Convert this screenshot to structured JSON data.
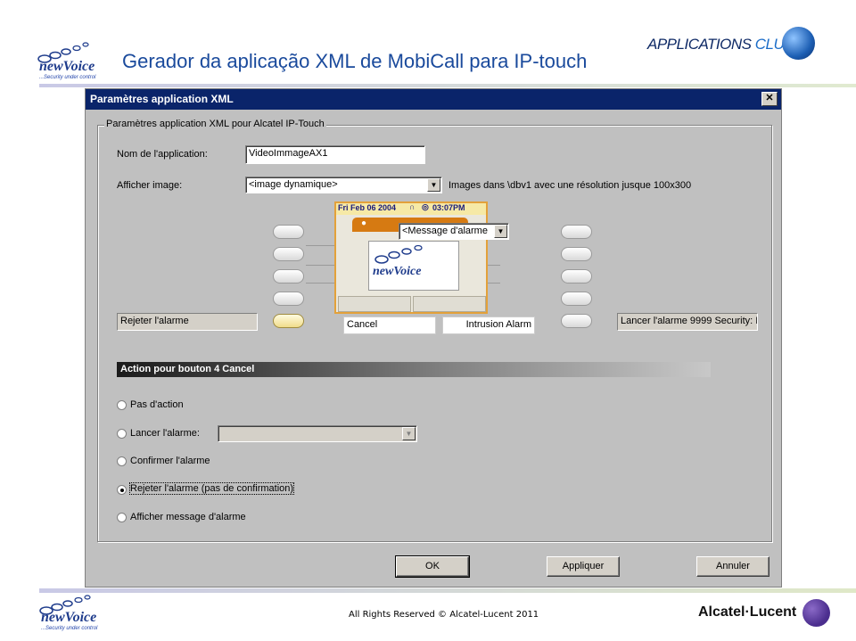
{
  "slide": {
    "title": "Gerador da aplicação XML de MobiCall para IP-touch",
    "brand_word": "newVoice",
    "brand_tag": "...Security under control",
    "apps_club_a": "APPLICATIONS",
    "apps_club_b": "CLUB",
    "copyright": "All Rights Reserved © Alcatel-Lucent 2011",
    "vendor": "Alcatel·Lucent"
  },
  "dialog": {
    "title": "Paramètres application XML",
    "close_glyph": "✕",
    "group_label": "Paramètres application XML pour Alcatel IP-Touch",
    "app_name_label": "Nom de l'application:",
    "app_name_value": "VideoImmageAX1",
    "image_label": "Afficher image:",
    "image_value": "<image dynamique>",
    "image_hint": "Images dans \\dbv1 avec une résolution jusque 100x300",
    "left_field": "Rejeter l'alarme",
    "right_field": "Lancer l'alarme 9999 Security: I",
    "phone": {
      "date": "Fri Feb 06 2004",
      "time": "03:07PM",
      "message_combo": "<Message d'alarme",
      "softkey_left": "Cancel",
      "softkey_right": "Intrusion Alarm"
    },
    "action_header": "Action pour bouton 4  Cancel",
    "radios": [
      {
        "label": "Pas d'action",
        "checked": false
      },
      {
        "label": "Lancer l'alarme:",
        "checked": false
      },
      {
        "label": "Confirmer l'alarme",
        "checked": false
      },
      {
        "label": "Rejeter l'alarme (pas de confirmation)",
        "checked": true
      },
      {
        "label": "Afficher message d'alarme",
        "checked": false
      }
    ],
    "buttons": {
      "ok": "OK",
      "apply": "Appliquer",
      "cancel": "Annuler"
    }
  },
  "colors": {
    "title_blue": "#1a4a9c",
    "titlebar": "#0a246a",
    "phone_orange": "#d67a12"
  }
}
